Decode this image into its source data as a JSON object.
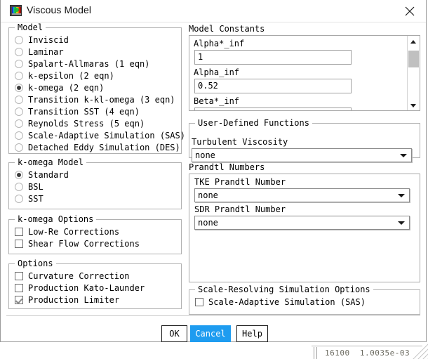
{
  "window": {
    "title": "Viscous Model",
    "icon": "fluent-app-icon",
    "close_label": "✕"
  },
  "model_group": {
    "legend": "Model",
    "items": [
      {
        "label": "Inviscid",
        "selected": false
      },
      {
        "label": "Laminar",
        "selected": false
      },
      {
        "label": "Spalart-Allmaras (1 eqn)",
        "selected": false
      },
      {
        "label": "k-epsilon (2 eqn)",
        "selected": false
      },
      {
        "label": "k-omega (2 eqn)",
        "selected": true
      },
      {
        "label": "Transition k-kl-omega (3 eqn)",
        "selected": false
      },
      {
        "label": "Transition SST (4 eqn)",
        "selected": false
      },
      {
        "label": "Reynolds Stress (5 eqn)",
        "selected": false
      },
      {
        "label": "Scale-Adaptive Simulation (SAS)",
        "selected": false
      },
      {
        "label": "Detached Eddy Simulation (DES)",
        "selected": false
      }
    ]
  },
  "komega_model_group": {
    "legend": "k-omega Model",
    "items": [
      {
        "label": "Standard",
        "selected": true
      },
      {
        "label": "BSL",
        "selected": false
      },
      {
        "label": "SST",
        "selected": false
      }
    ]
  },
  "komega_options_group": {
    "legend": "k-omega Options",
    "items": [
      {
        "label": "Low-Re Corrections",
        "checked": false
      },
      {
        "label": "Shear Flow Corrections",
        "checked": false
      }
    ]
  },
  "options_group": {
    "legend": "Options",
    "items": [
      {
        "label": "Curvature Correction",
        "checked": false
      },
      {
        "label": "Production Kato-Launder",
        "checked": false
      },
      {
        "label": "Production Limiter",
        "checked": true
      }
    ]
  },
  "model_constants": {
    "title": "Model Constants",
    "fields": [
      {
        "label": "Alpha*_inf",
        "value": "1"
      },
      {
        "label": "Alpha_inf",
        "value": "0.52"
      },
      {
        "label": "Beta*_inf",
        "value": ""
      }
    ],
    "scroll_up_icon": "triangle-up-icon",
    "scroll_down_icon": "triangle-down-icon"
  },
  "udf_group": {
    "legend": "User-Defined Functions",
    "turbulent_viscosity_label": "Turbulent Viscosity",
    "turbulent_viscosity_value": "none"
  },
  "prandtl_group": {
    "title": "Prandtl Numbers",
    "tke_label": "TKE Prandtl Number",
    "tke_value": "none",
    "sdr_label": "SDR Prandtl Number",
    "sdr_value": "none"
  },
  "srs_group": {
    "legend": "Scale-Resolving Simulation Options",
    "items": [
      {
        "label": "Scale-Adaptive Simulation (SAS)",
        "checked": false
      }
    ]
  },
  "buttons": {
    "ok": "OK",
    "cancel": "Cancel",
    "help": "Help"
  },
  "background": {
    "console_line": "16100  1.0035e-03"
  },
  "colors": {
    "accent": "#1e9cf0",
    "dialog_bg": "#ffffff",
    "border": "#b0b0b0",
    "text": "#000000"
  }
}
